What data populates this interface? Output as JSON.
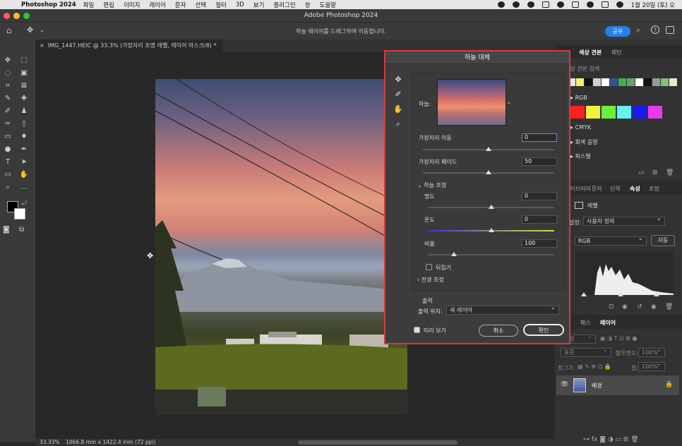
{
  "menubar": {
    "app_name": "Photoshop 2024",
    "items": [
      "파일",
      "편집",
      "이미지",
      "레이어",
      "문자",
      "선택",
      "필터",
      "3D",
      "보기",
      "플러그인",
      "창",
      "도움말"
    ],
    "clock": "1월 20일 (토) 오"
  },
  "window": {
    "title": "Adobe Photoshop 2024"
  },
  "options_bar": {
    "hint": "하늘 레이어를 드래그하여 이동합니다.",
    "share_label": "공유"
  },
  "document": {
    "tab_label": "IMG_1447.HEIC @ 33.3% (가장자리 조명 레벨, 레이어 마스크/8) *"
  },
  "status": {
    "zoom": "33.33%",
    "doc_info": "1066.8 mm x 1422.4 mm (72 ppi)"
  },
  "swatches_panel": {
    "tabs": [
      "색상 견본",
      "패턴"
    ],
    "search_placeholder": "색상 견본 검색",
    "recent_colors": [
      "#e6e6e6",
      "#f5f068",
      "#111111",
      "#cfcfcf",
      "#ffffff",
      "#3a4f9a",
      "#3fb14d",
      "#6b9e6a",
      "#ffffff",
      "#111111",
      "#999999",
      "#7fbf7f",
      "#efe6c8"
    ],
    "groups": [
      {
        "name": "RGB",
        "colors": [
          "#ff2020",
          "#f2f23a",
          "#69f23a",
          "#66f2f2",
          "#1a1aee",
          "#e83ae8"
        ]
      },
      {
        "name": "CMYK"
      },
      {
        "name": "회색 음영"
      },
      {
        "name": "파스텔"
      }
    ]
  },
  "properties_panel": {
    "tabs": [
      "라이브러리",
      "문자",
      "단락",
      "속성",
      "조정"
    ],
    "active_tab": "속성",
    "section_label": "레벨",
    "preset_label": "설정:",
    "preset_value": "사용자 정의",
    "channel_value": "RGB",
    "auto_label": "자동"
  },
  "layers_panel": {
    "tabs": [
      "패스",
      "레이어"
    ],
    "active_tab": "레이어",
    "kind_label": "유형",
    "blend_mode": "표준",
    "opacity_label": "불투명도:",
    "opacity_value": "100%",
    "lock_label": "잠그기:",
    "fill_label": "칠:",
    "fill_value": "100%",
    "layer_name": "배경"
  },
  "sky_dialog": {
    "title": "하늘 대체",
    "sky_label": "하늘:",
    "edge_shift_label": "가장자리 이동",
    "edge_shift_value": "0",
    "edge_shift_pos": 0.5,
    "edge_fade_label": "가장자리 페이드",
    "edge_fade_value": "50",
    "edge_fade_pos": 0.5,
    "sky_adjust_label": "하늘 조정",
    "brightness_label": "명도",
    "brightness_value": "0",
    "brightness_pos": 0.5,
    "temperature_label": "온도",
    "temperature_value": "0",
    "temperature_pos": 0.5,
    "scale_label": "비율",
    "scale_value": "100",
    "scale_pos": 0.2,
    "flip_label": "뒤집기",
    "flip_checked": false,
    "foreground_label": "전경 조정",
    "output_heading": "출력",
    "output_to_label": "출력 위치:",
    "output_to_value": "새 레이어",
    "preview_label": "미리 보기",
    "preview_checked": true,
    "cancel_label": "취소",
    "ok_label": "확인"
  },
  "colors": {
    "accent": "#2680eb",
    "dialog_highlight": "#d63a3a"
  }
}
